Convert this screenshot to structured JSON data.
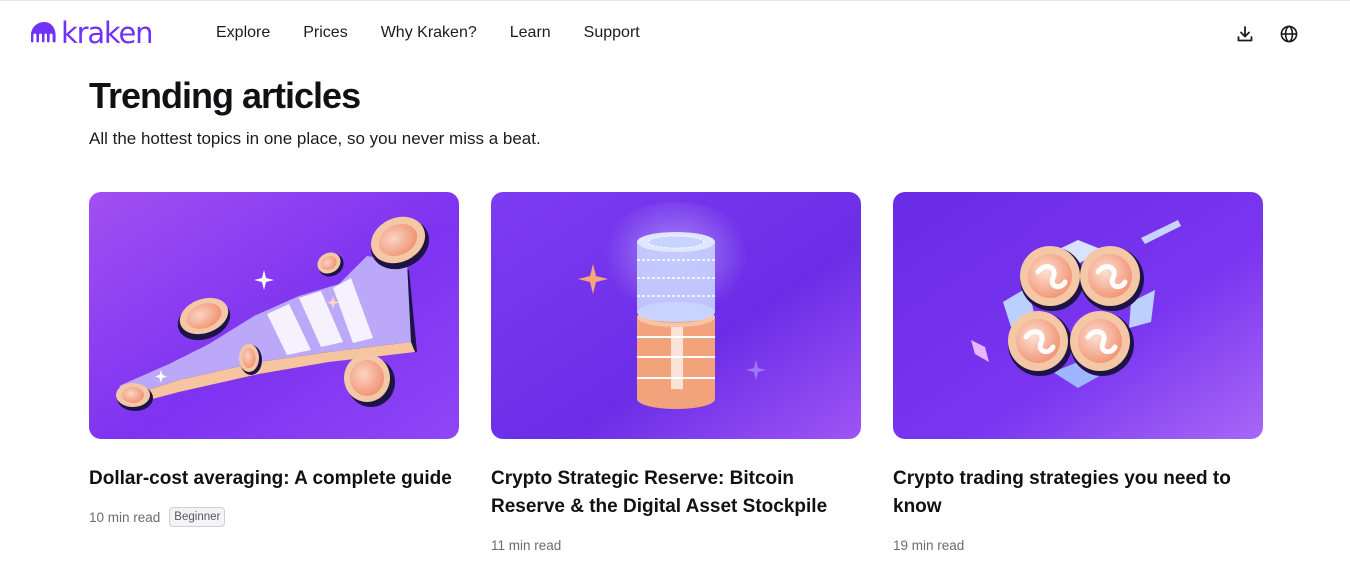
{
  "header": {
    "logo_text": "kraken",
    "brand_color": "#7132f5",
    "nav": [
      "Explore",
      "Prices",
      "Why Kraken?",
      "Learn",
      "Support"
    ],
    "icons": [
      "download-icon",
      "globe-icon"
    ]
  },
  "section": {
    "title": "Trending articles",
    "subtitle": "All the hottest topics in one place, so you never miss a beat."
  },
  "articles": [
    {
      "title": "Dollar-cost averaging: A complete guide",
      "read_time": "10 min read",
      "badge": "Beginner",
      "illustration": "coins-rising-chart-illustration"
    },
    {
      "title": "Crypto Strategic Reserve: Bitcoin Reserve & the Digital Asset Stockpile",
      "read_time": "11 min read",
      "illustration": "coin-stack-illustration"
    },
    {
      "title": "Crypto trading strategies you need to know",
      "read_time": "19 min read",
      "illustration": "coin-cluster-illustration"
    }
  ]
}
